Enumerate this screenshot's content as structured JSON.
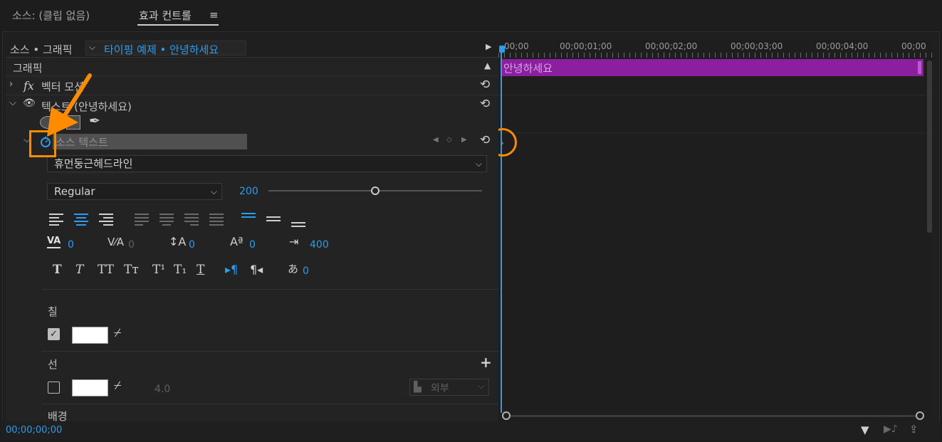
{
  "tabs": [
    {
      "label": "소스: (클립 없음)"
    },
    {
      "label": "효과 컨트롤"
    }
  ],
  "header": {
    "source_label": "소스 • 그래픽",
    "sequence_label": "타이핑 예제 • 안녕하세요"
  },
  "sections": {
    "graphics": "그래픽",
    "vector_motion": "벡터 모션",
    "text_layer": "텍스트 (안녕하세요)",
    "source_text": "소스 텍스트"
  },
  "font": {
    "family": "휴먼둥근헤드라인",
    "style": "Regular",
    "size": "200",
    "size_fraction": 0.5
  },
  "metrics": {
    "kerning": "0",
    "tracking": "0",
    "leading": "0",
    "baseline": "0",
    "tab_width": "400",
    "tsume": "0"
  },
  "appearance": {
    "fill_label": "칠",
    "stroke_label": "선",
    "stroke_width": "4.0",
    "stroke_position": "외부",
    "background_label": "배경"
  },
  "timeline": {
    "ruler": [
      "00;00",
      "00;00;01;00",
      "00;00;02;00",
      "00;00;03;00",
      "00;00;04;00",
      "00;00"
    ],
    "clip_label": "안녕하세요"
  },
  "status": {
    "timecode": "00;00;00;00"
  },
  "colors": {
    "accent": "#2d9cf0",
    "clip": "#8c1ea0",
    "annotation": "#ff8c00"
  }
}
